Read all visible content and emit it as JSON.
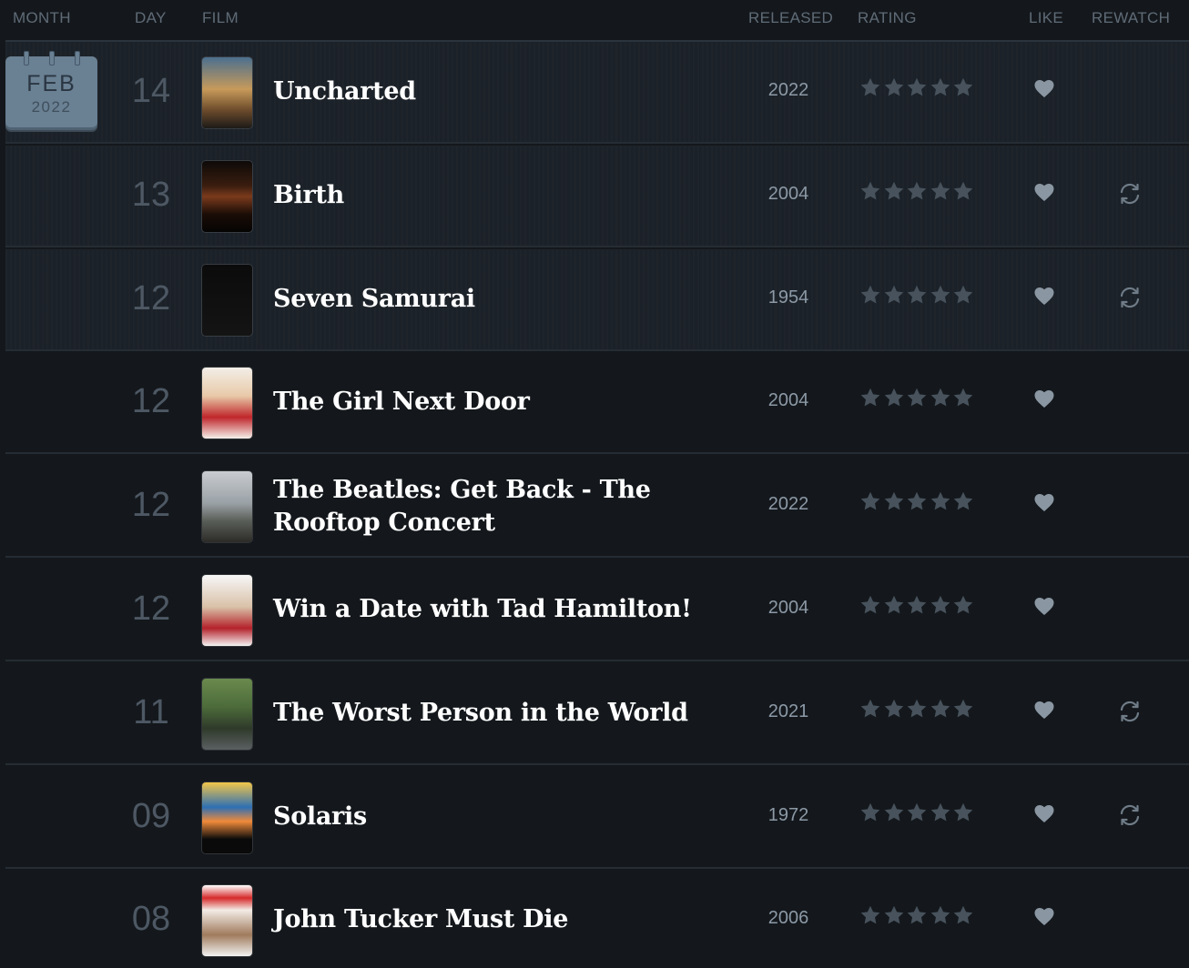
{
  "headers": {
    "month": "MONTH",
    "day": "DAY",
    "film": "FILM",
    "released": "RELEASED",
    "rating": "RATING",
    "like": "LIKE",
    "rewatch": "REWATCH"
  },
  "month_badge": {
    "month": "FEB",
    "year": "2022",
    "icon": "calendar-icon"
  },
  "colors": {
    "background": "#14181c",
    "row_highlight": "#1b2128",
    "star": "#47525c",
    "heart": "#8a97a3",
    "rewatch": "#6f7c88"
  },
  "entries": [
    {
      "day": "14",
      "title": "Uncharted",
      "released": "2022",
      "rating_stars": 5,
      "liked": true,
      "rewatch": false
    },
    {
      "day": "13",
      "title": "Birth",
      "released": "2004",
      "rating_stars": 5,
      "liked": true,
      "rewatch": true
    },
    {
      "day": "12",
      "title": "Seven Samurai",
      "released": "1954",
      "rating_stars": 5,
      "liked": true,
      "rewatch": true
    },
    {
      "day": "12",
      "title": "The Girl Next Door",
      "released": "2004",
      "rating_stars": 5,
      "liked": true,
      "rewatch": false
    },
    {
      "day": "12",
      "title": "The Beatles: Get Back - The Rooftop Concert",
      "released": "2022",
      "rating_stars": 5,
      "liked": true,
      "rewatch": false
    },
    {
      "day": "12",
      "title": "Win a Date with Tad Hamilton!",
      "released": "2004",
      "rating_stars": 5,
      "liked": true,
      "rewatch": false
    },
    {
      "day": "11",
      "title": "The Worst Person in the World",
      "released": "2021",
      "rating_stars": 5,
      "liked": true,
      "rewatch": true
    },
    {
      "day": "09",
      "title": "Solaris",
      "released": "1972",
      "rating_stars": 5,
      "liked": true,
      "rewatch": true
    },
    {
      "day": "08",
      "title": "John Tucker Must Die",
      "released": "2006",
      "rating_stars": 5,
      "liked": true,
      "rewatch": false
    }
  ]
}
